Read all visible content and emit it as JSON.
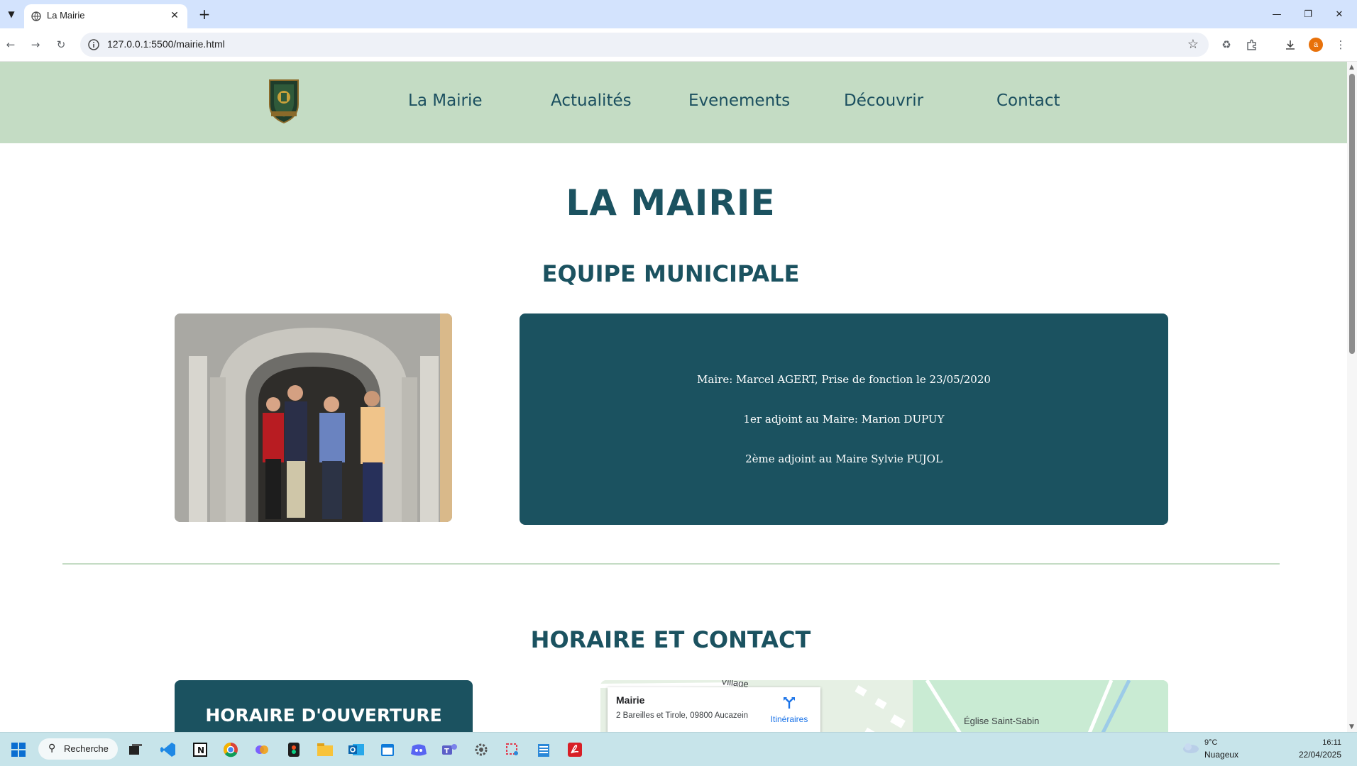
{
  "browser": {
    "tab_title": "La Mairie",
    "url": "127.0.0.1:5500/mairie.html",
    "profile_initial": "a"
  },
  "nav": {
    "links": [
      "La Mairie",
      "Actualités",
      "Evenements",
      "Découvrir",
      "Contact"
    ]
  },
  "page": {
    "title": "LA MAIRIE",
    "section_team": "EQUIPE MUNICIPALE",
    "team_lines": [
      "Maire: Marcel AGERT, Prise de fonction le 23/05/2020",
      "1er adjoint au Maire: Marion DUPUY",
      "2ème adjoint au Maire Sylvie PUJOL"
    ],
    "section_hours": "HORAIRE ET CONTACT",
    "hours_title": "HORAIRE D'OUVERTURE",
    "map": {
      "place_name": "Mairie",
      "address": "2 Bareilles et Tirole, 09800 Aucazein",
      "directions": "Itinéraires",
      "label_village": "Village",
      "label_church": "Église Saint-Sabin"
    }
  },
  "taskbar": {
    "search_label": "Recherche",
    "weather_temp": "9°C",
    "weather_desc": "Nuageux",
    "time": "16:11",
    "date": "22/04/2025"
  },
  "colors": {
    "nav_bg": "#c4dcc4",
    "accent_teal": "#1b5260",
    "tabbar_bg": "#d3e3fd",
    "taskbar_bg": "#c7e4ea"
  }
}
